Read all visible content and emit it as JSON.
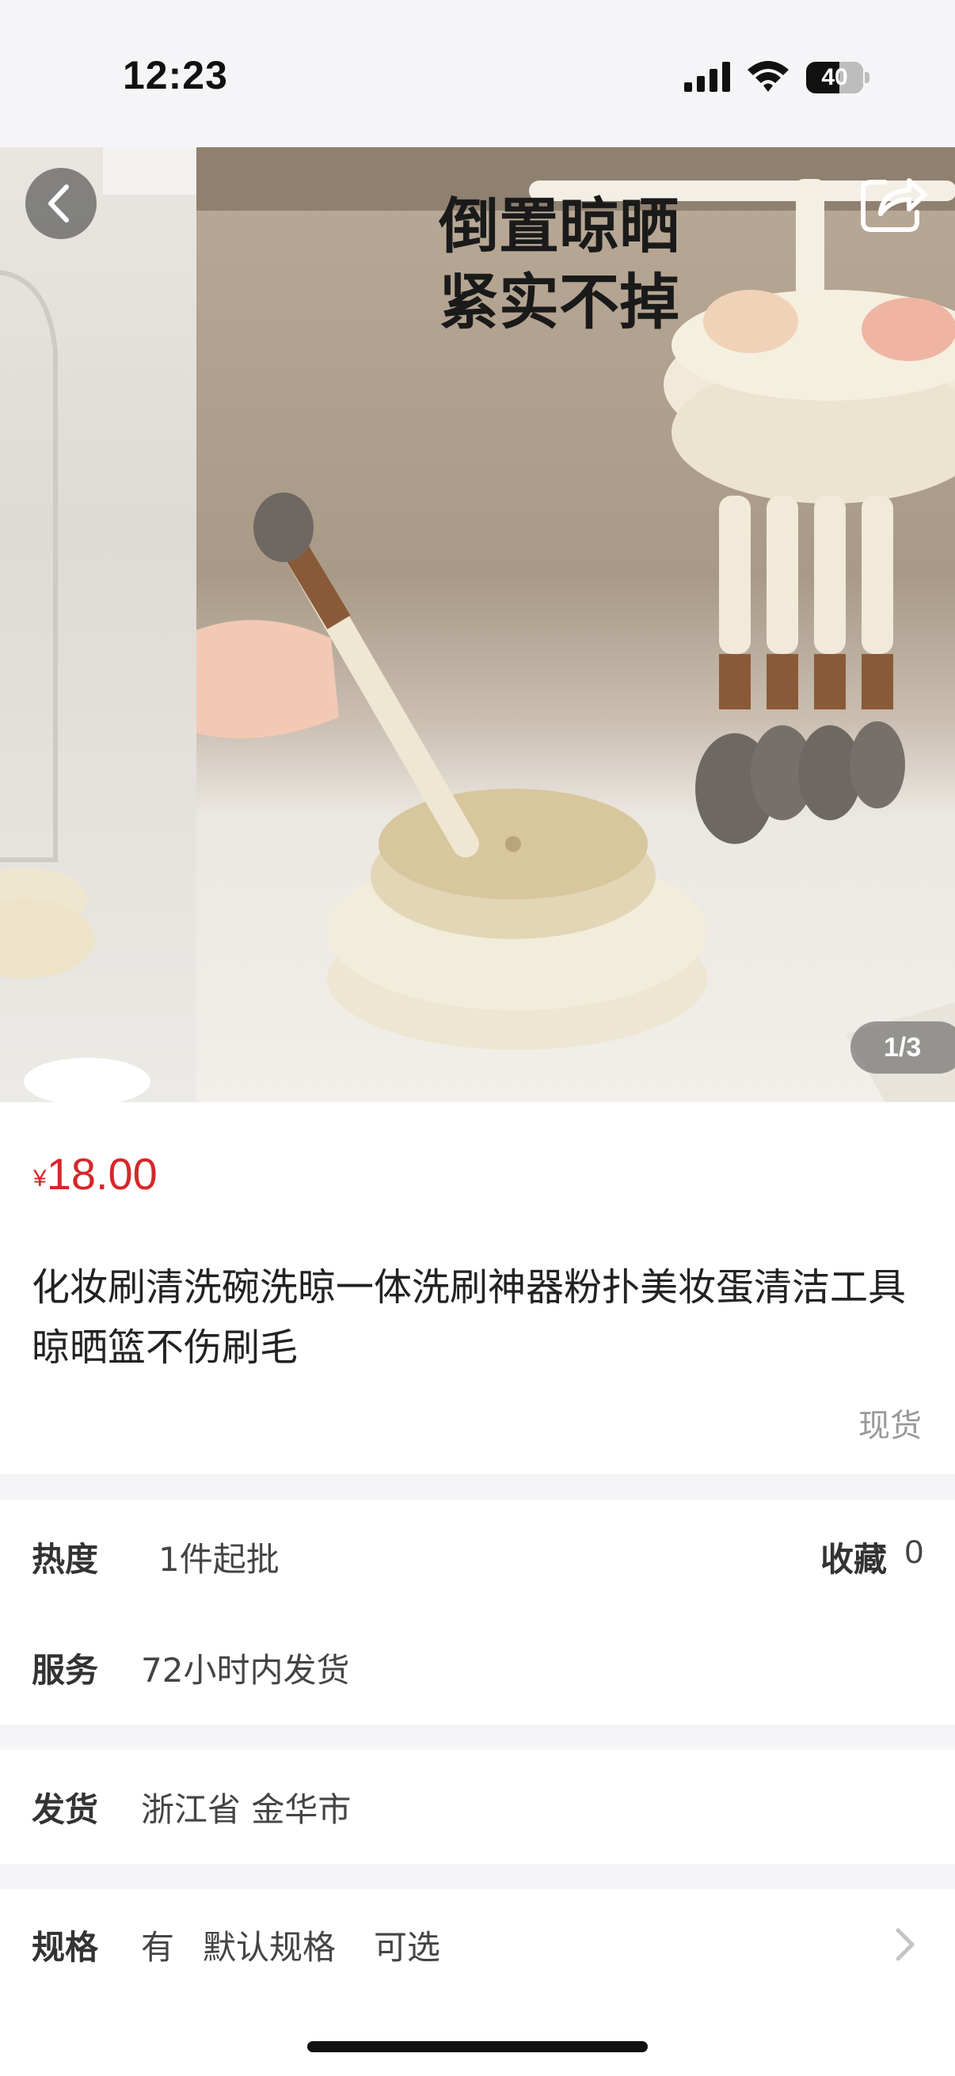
{
  "status_bar": {
    "time": "12:23",
    "battery": "40"
  },
  "gallery": {
    "overlay_text_line1": "倒置晾晒",
    "overlay_text_line2": "紧实不掉",
    "counter": "1/3"
  },
  "product": {
    "currency": "¥",
    "price": "18.00",
    "title": "化妆刷清洗碗洗晾一体洗刷神器粉扑美妆蛋清洁工具晾晒篮不伤刷毛",
    "stock": "现货"
  },
  "info": {
    "heat_label": "热度",
    "heat_value": "1件起批",
    "favorite_label": "收藏",
    "favorite_count": "0",
    "service_label": "服务",
    "service_value": "72小时内发货",
    "ship_label": "发货",
    "ship_value": "浙江省 金华市",
    "spec_label": "规格",
    "spec_value_1": "有",
    "spec_value_2": "默认规格",
    "spec_value_3": "可选"
  }
}
